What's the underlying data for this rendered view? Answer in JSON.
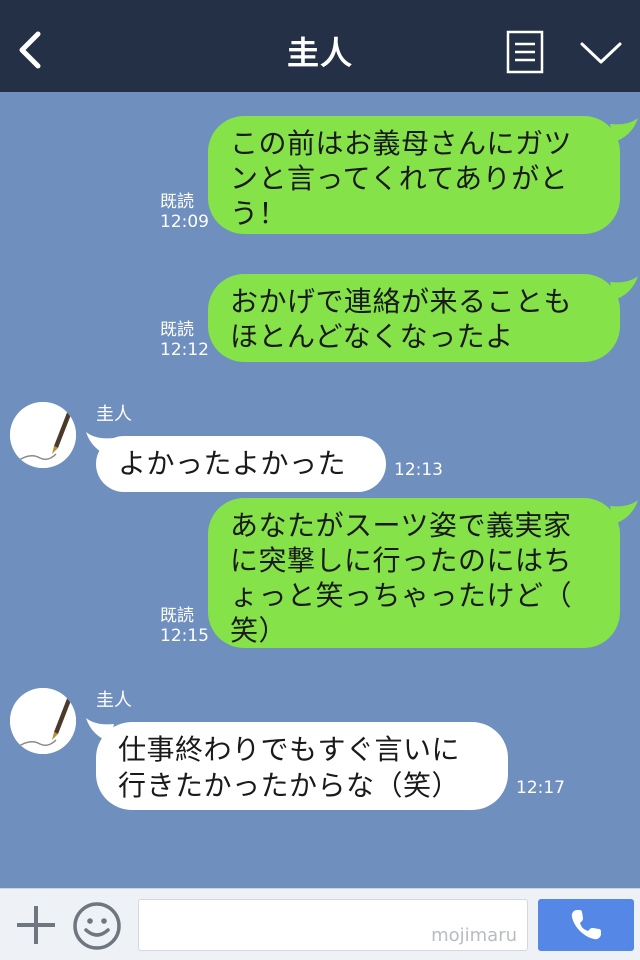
{
  "header": {
    "title": "圭人",
    "back_icon": "chevron-left-icon",
    "menu_icon": "notes-icon",
    "collapse_icon": "chevron-down-icon",
    "background": "#243046"
  },
  "chat": {
    "background": "#6f8fbf",
    "messages": [
      {
        "direction": "outgoing",
        "text": "この前はお義母さんにガツ\nンと言ってくれてありがと\nう！",
        "read_label": "既読",
        "time": "12:09"
      },
      {
        "direction": "outgoing",
        "text": "おかげで連絡が来ることも\nほとんどなくなったよ",
        "read_label": "既読",
        "time": "12:12"
      },
      {
        "direction": "incoming",
        "sender": "圭人",
        "text": "よかったよかった",
        "time": "12:13"
      },
      {
        "direction": "outgoing",
        "text": "あなたがスーツ姿で義実家\nに突撃しに行ったのにはち\nょっと笑っちゃったけど（\n笑）",
        "read_label": "既読",
        "time": "12:15"
      },
      {
        "direction": "incoming",
        "sender": "圭人",
        "text": "仕事終わりでもすぐ言いに\n行きたかったからな（笑）",
        "time": "12:17"
      }
    ],
    "outgoing_bubble_color": "#85e249",
    "incoming_bubble_color": "#ffffff"
  },
  "input_bar": {
    "plus_icon": "plus-icon",
    "emoji_icon": "smile-icon",
    "placeholder": "",
    "watermark": "mojimaru",
    "call_icon": "phone-icon",
    "call_button_color": "#5487e6"
  }
}
